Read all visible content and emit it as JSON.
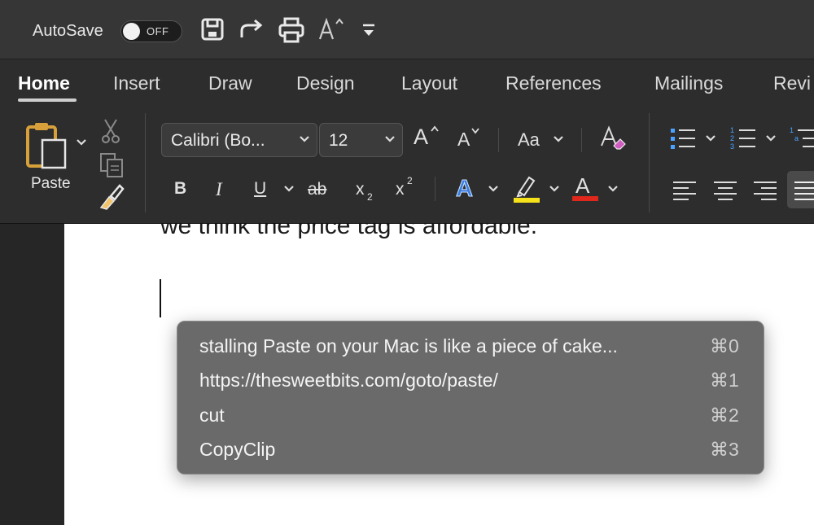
{
  "title_bar": {
    "autosave_label": "AutoSave",
    "autosave_state": "OFF",
    "quick_access_icons": [
      "save-icon",
      "redo-icon",
      "print-icon",
      "grow-font-icon",
      "customize-toolbar-icon"
    ]
  },
  "ribbon": {
    "tabs": [
      "Home",
      "Insert",
      "Draw",
      "Design",
      "Layout",
      "References",
      "Mailings",
      "Revi"
    ],
    "active_tab": "Home",
    "paste_label": "Paste",
    "font_name": "Calibri (Bo...",
    "font_size": "12",
    "grow_font_label": "A",
    "shrink_font_label": "A",
    "change_case_label": "Aa",
    "bold": "B",
    "italic": "I",
    "underline": "U",
    "strikethrough": "ab",
    "subscript": "x",
    "subscript_mark": "2",
    "superscript": "x",
    "superscript_mark": "2",
    "text_effects_label": "A",
    "font_color_label": "A",
    "highlight_color": "#f5e21a",
    "font_color": "#e0271c"
  },
  "document": {
    "visible_text": "we think the price tag is affordable."
  },
  "clipboard_popup": {
    "items": [
      {
        "text": "stalling Paste on your Mac is like a piece of cake...",
        "shortcut": "⌘0"
      },
      {
        "text": "https://thesweetbits.com/goto/paste/",
        "shortcut": "⌘1"
      },
      {
        "text": "cut",
        "shortcut": "⌘2"
      },
      {
        "text": "CopyClip",
        "shortcut": "⌘3"
      }
    ]
  }
}
